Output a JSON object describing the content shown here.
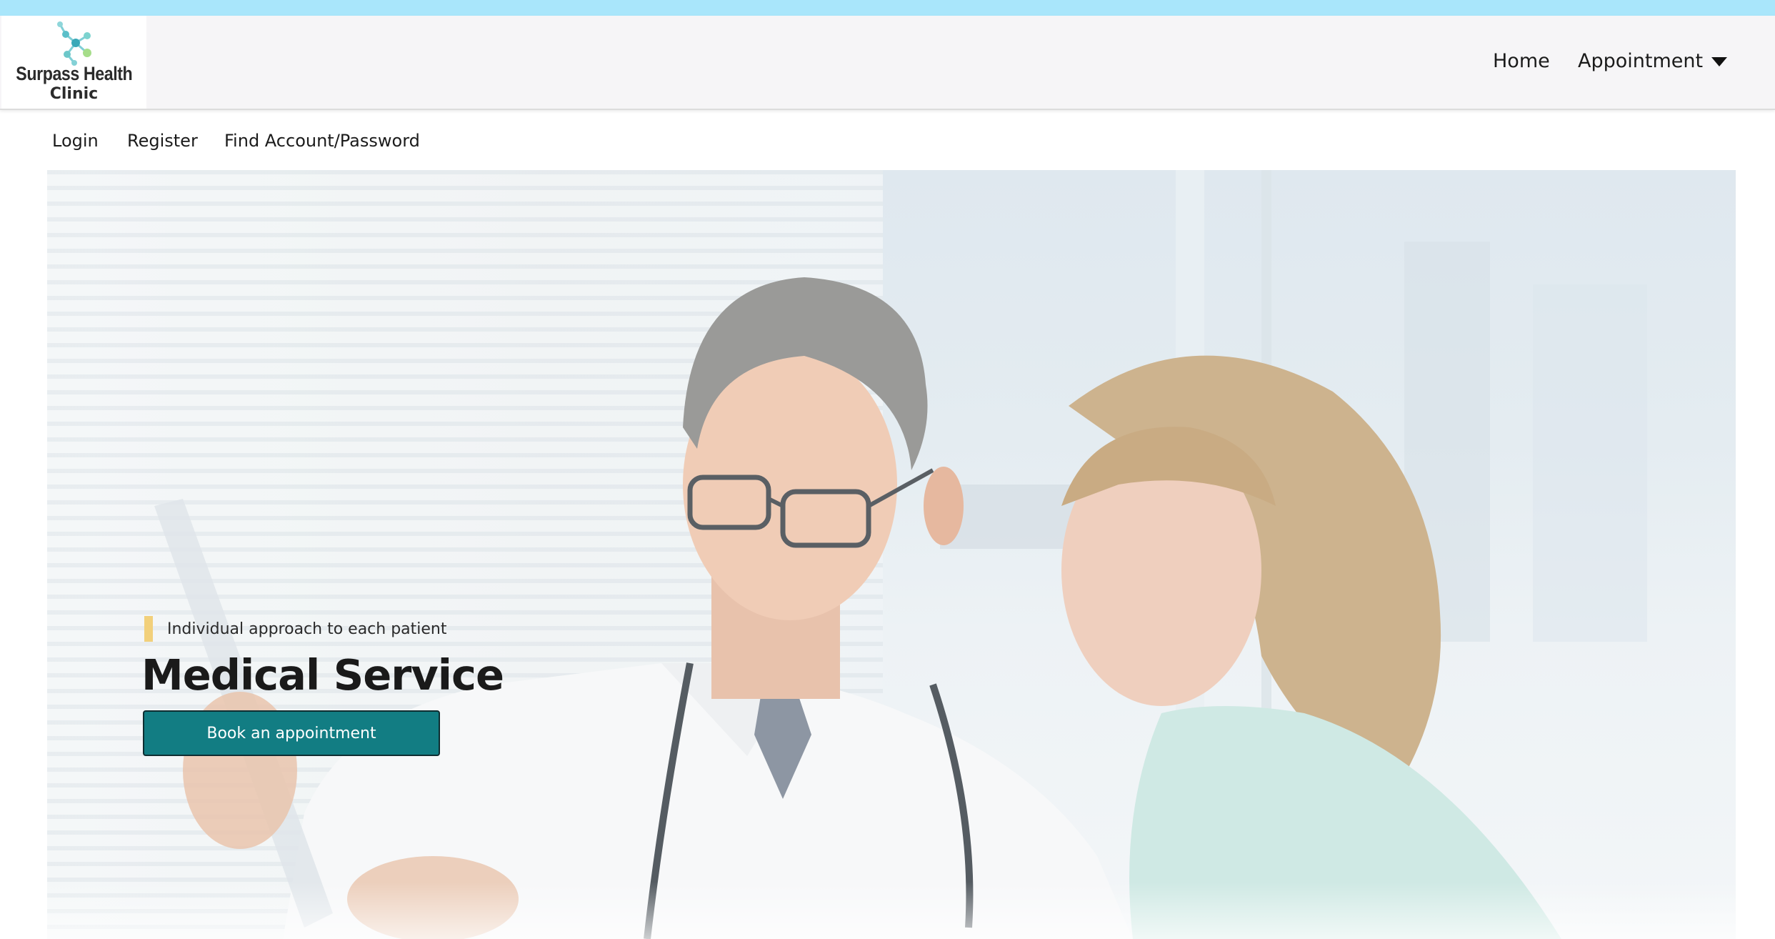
{
  "brand": {
    "name_line1": "Surpass Health",
    "name_line2": "Clinic",
    "logo_icon": "molecule-logo-icon"
  },
  "nav": {
    "home_label": "Home",
    "appointment_label": "Appointment",
    "appointment_icon": "caret-down-icon"
  },
  "subnav": {
    "login_label": "Login",
    "register_label": "Register",
    "find_account_label": "Find Account/Password"
  },
  "hero": {
    "tagline": "Individual approach to each patient",
    "title": "Medical Service",
    "cta_label": "Book an appointment"
  },
  "colors": {
    "top_strip": "#a9e6fb",
    "nav_bg": "#f6f5f7",
    "cta_bg": "#127d83",
    "tag_accent": "#f2d07b"
  }
}
